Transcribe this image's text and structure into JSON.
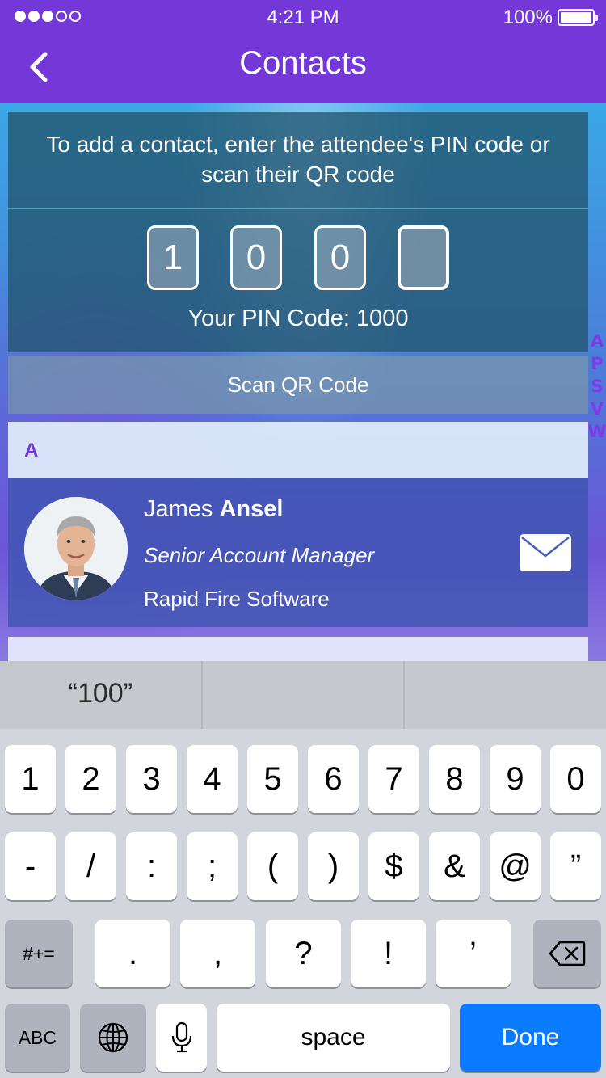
{
  "status_bar": {
    "time": "4:21 PM",
    "battery_percent": "100%",
    "signal": {
      "filled_dots": 3,
      "total_dots": 5
    }
  },
  "nav": {
    "title": "Contacts",
    "back_icon": "chevron-left-icon"
  },
  "pin_panel": {
    "instructions": "To add a contact, enter the attendee's PIN code or scan their QR code",
    "digits": [
      "1",
      "0",
      "0",
      ""
    ],
    "your_pin_label": "Your PIN Code: 1000"
  },
  "scan_button": {
    "label": "Scan QR Code"
  },
  "index_letters": [
    "A",
    "P",
    "S",
    "V",
    "W"
  ],
  "sections": [
    {
      "letter": "A",
      "contacts": [
        {
          "first_name": "James",
          "last_name": "Ansel",
          "title": "Senior Account Manager",
          "company": "Rapid Fire Software",
          "action_icon": "mail-icon"
        }
      ]
    }
  ],
  "predictive": {
    "suggestions": [
      "“100”",
      "",
      ""
    ]
  },
  "keyboard": {
    "row1": [
      "1",
      "2",
      "3",
      "4",
      "5",
      "6",
      "7",
      "8",
      "9",
      "0"
    ],
    "row2": [
      "-",
      "/",
      ":",
      ";",
      "(",
      ")",
      "$",
      "&",
      "@",
      "”"
    ],
    "row3": [
      ".",
      ",",
      "?",
      "!",
      "’"
    ],
    "more_symbols_label": "#+=",
    "abc_label": "ABC",
    "space_label": "space",
    "done_label": "Done",
    "icons": {
      "delete": "backspace-icon",
      "globe": "globe-icon",
      "mic": "microphone-icon"
    },
    "colors": {
      "done": "#0a7aff",
      "accent": "#7437d8"
    }
  }
}
